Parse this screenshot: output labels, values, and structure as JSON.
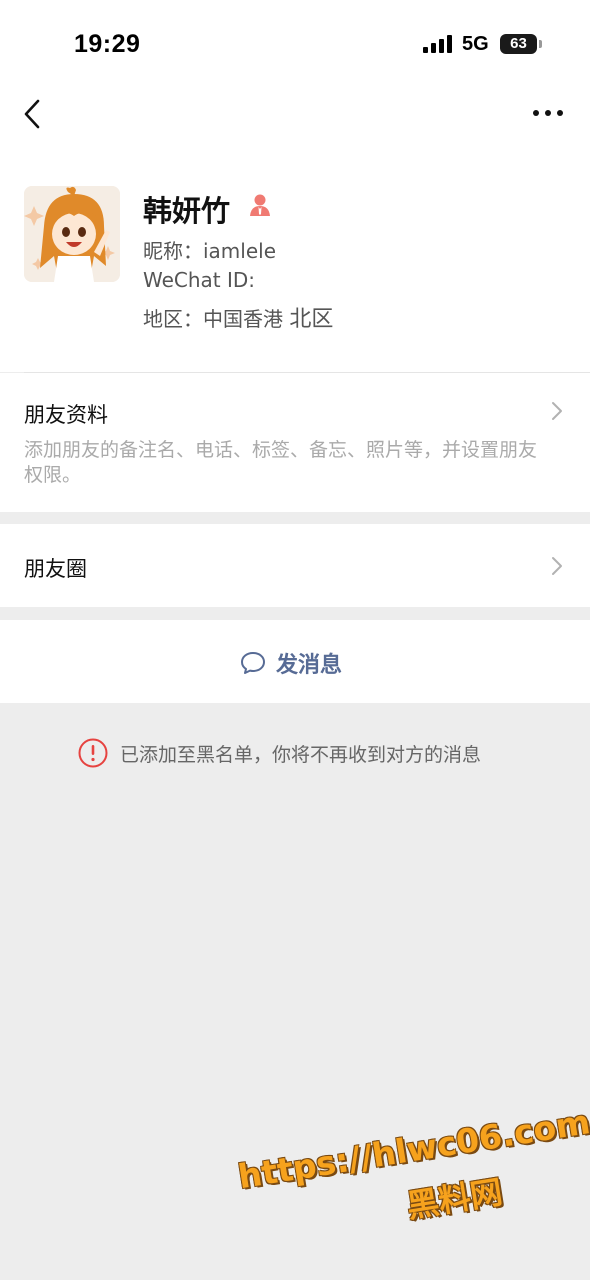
{
  "status_bar": {
    "time": "19:29",
    "network": "5G",
    "battery": "63"
  },
  "nav": {
    "back_icon": "chevron-left-icon",
    "more_icon": "more-dots-icon"
  },
  "profile": {
    "name": "韩妍竹",
    "nickname": "昵称：iamlele",
    "wechat_id": "WeChat ID:",
    "region": "地区：中国香港",
    "region_extra": "北区",
    "badge_icon": "person-badge-icon"
  },
  "friend_info": {
    "title": "朋友资料",
    "description": "添加朋友的备注名、电话、标签、备忘、照片等，并设置朋友权限。"
  },
  "moments": {
    "title": "朋友圈"
  },
  "actions": {
    "send_message": "发消息"
  },
  "notice": {
    "text": "已添加至黑名单，你将不再收到对方的消息"
  },
  "watermark": {
    "url": "https://hlwc06.com",
    "name": "黑料网"
  },
  "colors": {
    "link": "#576b95",
    "warning": "#e64340",
    "background": "#ededed",
    "watermark": "#f6a21d"
  }
}
